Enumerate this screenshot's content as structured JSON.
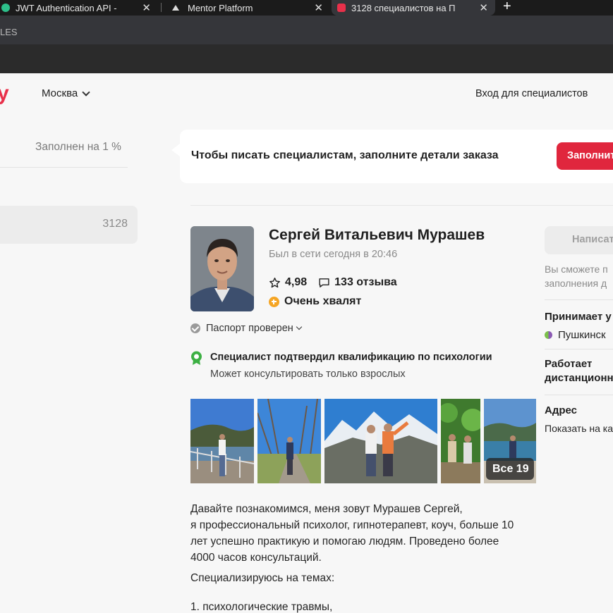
{
  "browser": {
    "tabs": [
      {
        "title": "JWT Authentication API -",
        "close": "✕"
      },
      {
        "title": "Mentor Platform",
        "close": "✕"
      },
      {
        "title": "3128 специалистов на П",
        "close": "✕"
      }
    ],
    "new_tab": "+",
    "bookmarks_fragment": "LES"
  },
  "header": {
    "logo_fragment": "y",
    "city": "Москва",
    "login_link": "Вход для специалистов"
  },
  "sidebar": {
    "filled_text": "Заполнен на 1 %",
    "count": "3128"
  },
  "banner": {
    "text": "Чтобы писать специалистам, заполните детали заказа",
    "button": "Заполнить"
  },
  "profile": {
    "name": "Сергей Витальевич Мурашев",
    "last_seen": "Был в сети сегодня в 20:46",
    "rating": "4,98",
    "reviews": "133 отзыва",
    "praise": "Очень хвалят",
    "passport": "Паспорт проверен",
    "qualification_title": "Специалист подтвердил квалификацию по психологии",
    "qualification_note": "Может консультировать только взрослых",
    "photos_all": "Все 19",
    "about_lines": [
      "Давайте познакомимся, меня зовут Мурашев Сергей,",
      "я профессиональный психолог, гипнотерапевт, коуч, больше 10",
      "лет успешно практикую и помогаю людям. Проведено более",
      "4000 часов консультаций."
    ],
    "specializes": "Специализируюсь на темах:",
    "topic_1": "1.  психологические травмы,"
  },
  "right_panel": {
    "write_button": "Написать",
    "write_note_lines": [
      "Вы сможете п",
      "заполнения д"
    ],
    "accepts_title": "Принимает у",
    "metro": "Пушкинск",
    "works_title_lines": [
      "Работает",
      "дистанционн"
    ],
    "address_title": "Адрес",
    "map_link": "Показать на ка"
  },
  "colors": {
    "accent": "#e0263d",
    "praise": "#f5a524",
    "verified_green": "#3cb043"
  }
}
